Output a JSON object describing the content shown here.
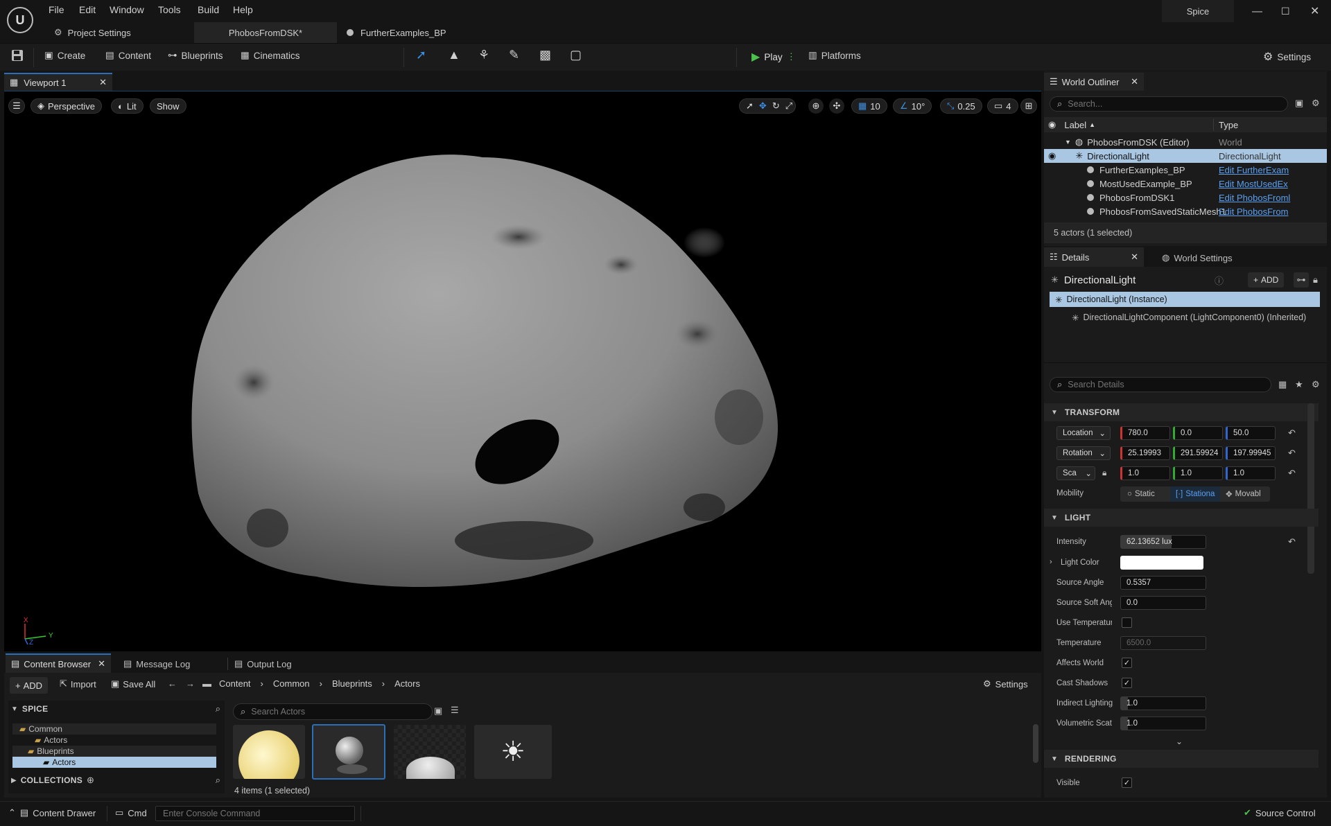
{
  "titlebar": {
    "menu": [
      "File",
      "Edit",
      "Window",
      "Tools",
      "Build",
      "Help"
    ],
    "project_name": "Spice",
    "tabs": [
      "Project Settings",
      "PhobosFromDSK*",
      "FurtherExamples_BP"
    ]
  },
  "toolbar": {
    "create": "Create",
    "content": "Content",
    "blueprints": "Blueprints",
    "cinematics": "Cinematics",
    "play": "Play",
    "platforms": "Platforms",
    "settings": "Settings"
  },
  "viewport": {
    "tab_label": "Viewport 1",
    "perspective": "Perspective",
    "lit": "Lit",
    "show": "Show",
    "grid_snap": "10",
    "rot_snap": "10°",
    "scale_snap": "0.25",
    "camera_speed": "4",
    "axis_x": "X",
    "axis_y": "Y",
    "axis_z": "Z"
  },
  "bottom": {
    "tabs": [
      "Content Browser",
      "Message Log",
      "Output Log"
    ],
    "add": "ADD",
    "import": "Import",
    "save_all": "Save All",
    "breadcrumb": [
      "Content",
      "Common",
      "Blueprints",
      "Actors"
    ],
    "settings": "Settings",
    "spice_header": "SPICE",
    "tree": [
      "Common",
      "Actors",
      "Blueprints",
      "Actors"
    ],
    "collections": "COLLECTIONS",
    "search_placeholder": "Search Actors",
    "item_count": "4 items (1 selected)"
  },
  "outliner": {
    "tab": "World Outliner",
    "search_placeholder": "Search...",
    "col_label": "Label",
    "col_type": "Type",
    "rows": [
      {
        "label": "PhobosFromDSK (Editor)",
        "type": "World"
      },
      {
        "label": "DirectionalLight",
        "type": "DirectionalLight"
      },
      {
        "label": "FurtherExamples_BP",
        "type": "Edit FurtherExam"
      },
      {
        "label": "MostUsedExample_BP",
        "type": "Edit MostUsedEx"
      },
      {
        "label": "PhobosFromDSK1",
        "type": "Edit PhobosFroml"
      },
      {
        "label": "PhobosFromSavedStaticMesh1",
        "type": "Edit PhobosFrom"
      }
    ],
    "footer": "5 actors (1 selected)"
  },
  "details": {
    "tab": "Details",
    "world_settings_tab": "World Settings",
    "actor_name": "DirectionalLight",
    "add": "ADD",
    "instance": "DirectionalLight (Instance)",
    "component": "DirectionalLightComponent (LightComponent0) (Inherited)",
    "search_placeholder": "Search Details",
    "transform_header": "TRANSFORM",
    "location_label": "Location",
    "location": [
      "780.0",
      "0.0",
      "50.0"
    ],
    "rotation_label": "Rotation",
    "rotation": [
      "25.19993",
      "291.59924",
      "197.99945"
    ],
    "scale_label": "Sca",
    "scale": [
      "1.0",
      "1.0",
      "1.0"
    ],
    "mobility_label": "Mobility",
    "mobility": [
      "Static",
      "Stationa",
      "Movabl"
    ],
    "light_header": "LIGHT",
    "intensity_label": "Intensity",
    "intensity": "62.13652 lux",
    "light_color_label": "Light Color",
    "source_angle_label": "Source Angle",
    "source_angle": "0.5357",
    "source_soft_label": "Source Soft Ang",
    "source_soft": "0.0",
    "use_temp_label": "Use Temperatur",
    "temperature_label": "Temperature",
    "temperature": "6500.0",
    "affects_world_label": "Affects World",
    "cast_shadows_label": "Cast Shadows",
    "indirect_label": "Indirect Lighting",
    "indirect": "1.0",
    "volumetric_label": "Volumetric Scat",
    "volumetric": "1.0",
    "rendering_header": "RENDERING",
    "visible_label": "Visible"
  },
  "status": {
    "content_drawer": "Content Drawer",
    "cmd": "Cmd",
    "console_placeholder": "Enter Console Command",
    "source_control": "Source Control"
  }
}
